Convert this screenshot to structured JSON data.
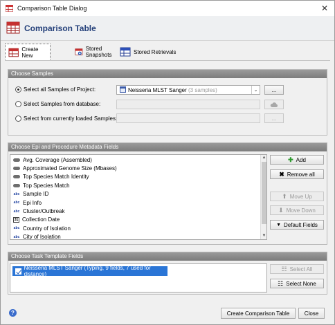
{
  "window": {
    "title": "Comparison Table Dialog",
    "close_glyph": "✕"
  },
  "header": {
    "title": "Comparison Table",
    "icon": "table-icon"
  },
  "tabs": [
    {
      "label": "Create New",
      "icon": "table-new-icon",
      "active": true
    },
    {
      "label": "Stored Snapshots",
      "icon": "snapshot-icon",
      "active": false
    },
    {
      "label": "Stored Retrievals",
      "icon": "retrieval-icon",
      "active": false
    }
  ],
  "choose_samples": {
    "heading": "Choose Samples",
    "option_project": "Select all Samples of Project:",
    "option_database": "Select Samples from database:",
    "option_loaded": "Select from currently loaded Samples:",
    "project_value": "Neisseria MLST Sanger",
    "project_count": "(3 samples)",
    "browse_label": "..."
  },
  "epi_fields": {
    "heading": "Choose Epi and Procedure Metadata Fields",
    "items": [
      {
        "label": "Avg. Coverage (Assembled)",
        "icon": "pill"
      },
      {
        "label": "Approximated Genome Size (Mbases)",
        "icon": "pill"
      },
      {
        "label": "Top Species Match Identity",
        "icon": "pill"
      },
      {
        "label": "Top Species Match",
        "icon": "pill"
      },
      {
        "label": "Sample ID",
        "icon": "abc"
      },
      {
        "label": "Epi Info",
        "icon": "abc"
      },
      {
        "label": "Cluster/Outbreak",
        "icon": "abc"
      },
      {
        "label": "Collection Date",
        "icon": "cal"
      },
      {
        "label": "Country of Isolation",
        "icon": "abc"
      },
      {
        "label": "City of Isolation",
        "icon": "abc"
      }
    ],
    "add_label": "Add",
    "remove_all_label": "Remove all",
    "move_up_label": "Move Up",
    "move_down_label": "Move Down",
    "default_fields_label": "Default Fields"
  },
  "task_fields": {
    "heading": "Choose Task Template Fields",
    "item": "Neisseria MLST Sanger (Typing, 9 fields, 7 used for distance)",
    "select_all_label": "Select All",
    "select_none_label": "Select None"
  },
  "footer": {
    "create_label": "Create Comparison Table",
    "close_label": "Close",
    "help_glyph": "?"
  },
  "colors": {
    "selection": "#2a75d6",
    "header_title": "#24407a",
    "section_heading_bg": "#8a8a8a"
  }
}
